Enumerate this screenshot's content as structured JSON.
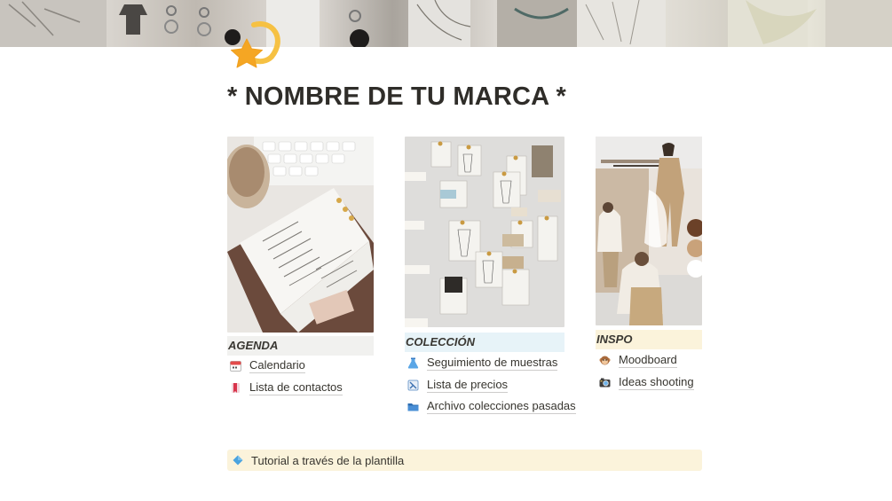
{
  "page": {
    "title": "* NOMBRE DE TU MARCA *",
    "page_icon": "star-icon",
    "cover": "moodboard-cover-image"
  },
  "columns": [
    {
      "label": "AGENDA",
      "label_bg": "#f1f1ef",
      "image": "planner-notebook-photo",
      "links": [
        {
          "label": "Calendario",
          "icon": "calendar-icon"
        },
        {
          "label": "Lista de contactos",
          "icon": "bookmark-icon"
        }
      ]
    },
    {
      "label": "COLECCIÓN",
      "label_bg": "#e7f3f8",
      "image": "fashion-sketches-wall-photo",
      "links": [
        {
          "label": "Seguimiento de muestras",
          "icon": "flask-icon"
        },
        {
          "label": "Lista de precios",
          "icon": "price-tag-icon"
        },
        {
          "label": "Archivo colecciones pasadas",
          "icon": "folder-icon"
        }
      ]
    },
    {
      "label": "INSPO",
      "label_bg": "#fbf3db",
      "image": "inspiration-collage-photo",
      "links": [
        {
          "label": "Moodboard",
          "icon": "monkey-icon"
        },
        {
          "label": "Ideas shooting",
          "icon": "camera-icon"
        }
      ]
    }
  ],
  "callout": {
    "label": "Tutorial a través de la plantilla",
    "icon": "diamond-icon",
    "bg": "#fbf3db"
  }
}
